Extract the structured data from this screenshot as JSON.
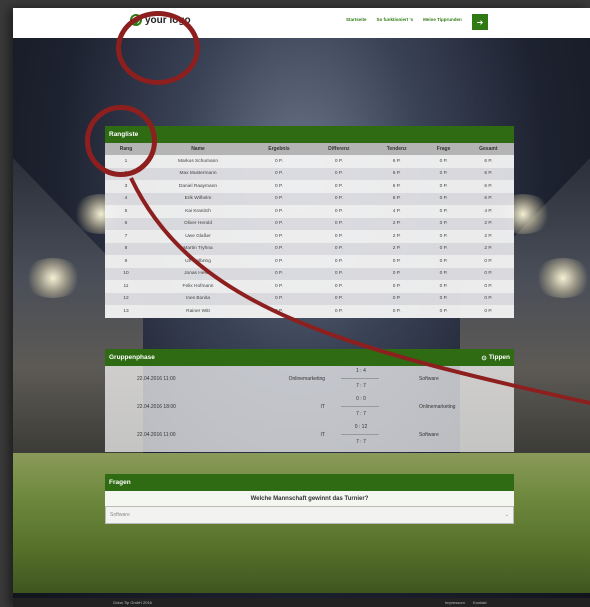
{
  "header": {
    "logo_text": "your logo",
    "nav": [
      "Startseite",
      "So funktioniert 's",
      "Meine Tipprunden"
    ],
    "nav_button_icon": "arrow-right-icon"
  },
  "rangliste": {
    "title": "Rangliste",
    "columns": [
      "Rang",
      "Name",
      "Ergebnis",
      "Differenz",
      "Tendenz",
      "Frage",
      "Gesamt"
    ],
    "rows": [
      [
        "1",
        "Markus Schumann",
        "0 P.",
        "0 P.",
        "6 P.",
        "0 P.",
        "6 P."
      ],
      [
        "2",
        "Max Mustermann",
        "0 P.",
        "0 P.",
        "6 P.",
        "0 P.",
        "6 P."
      ],
      [
        "3",
        "Daniel Raaymann",
        "0 P.",
        "0 P.",
        "6 P.",
        "0 P.",
        "6 P."
      ],
      [
        "4",
        "Erik Wilhelm",
        "0 P.",
        "0 P.",
        "6 P.",
        "0 P.",
        "6 P."
      ],
      [
        "5",
        "Kai Kranitch",
        "0 P.",
        "0 P.",
        "4 P.",
        "0 P.",
        "4 P."
      ],
      [
        "6",
        "Oliver Herold",
        "0 P.",
        "0 P.",
        "2 P.",
        "0 P.",
        "2 P."
      ],
      [
        "7",
        "Uwe Glaßer",
        "0 P.",
        "0 P.",
        "2 P.",
        "0 P.",
        "2 P."
      ],
      [
        "8",
        "Martin Tryhna",
        "0 P.",
        "0 P.",
        "2 P.",
        "0 P.",
        "2 P."
      ],
      [
        "9",
        "Uli Wolbring",
        "0 P.",
        "0 P.",
        "0 P.",
        "0 P.",
        "0 P."
      ],
      [
        "10",
        "Jonas Hesse",
        "0 P.",
        "0 P.",
        "0 P.",
        "0 P.",
        "0 P."
      ],
      [
        "11",
        "Felix Hofmann",
        "0 P.",
        "0 P.",
        "0 P.",
        "0 P.",
        "0 P."
      ],
      [
        "12",
        "Ines Bonita",
        "0 P.",
        "0 P.",
        "0 P.",
        "0 P.",
        "0 P."
      ],
      [
        "13",
        "Rainer Witt",
        "0 P.",
        "0 P.",
        "0 P.",
        "0 P.",
        "0 P."
      ]
    ]
  },
  "gruppenphase": {
    "title": "Gruppenphase",
    "tippen_label": "Tippen",
    "matches": [
      {
        "date": "22.04.2016 11:00",
        "team1": "Onlinemarketing",
        "team2": "Software",
        "score1": "1 : 4",
        "score2": "7 : 7"
      },
      {
        "date": "22.04.2016 18:00",
        "team1": "IT",
        "team2": "Onlinemarketing",
        "score1": "0 : 0",
        "score2": "7 : 7"
      },
      {
        "date": "22.04.2016 11:00",
        "team1": "IT",
        "team2": "Software",
        "score1": "0 : 12",
        "score2": "7 : 7"
      }
    ]
  },
  "fragen": {
    "title": "Fragen",
    "question": "Welche Mannschaft gewinnt das Turnier?",
    "selected": "Software"
  },
  "footer": {
    "left": "Goba Tip GmbH 2016",
    "impressum": "Impressum",
    "kontakt": "Kontakt"
  },
  "colors": {
    "brand_green": "#2f6b12",
    "annotation_red": "#8e1f1f"
  }
}
